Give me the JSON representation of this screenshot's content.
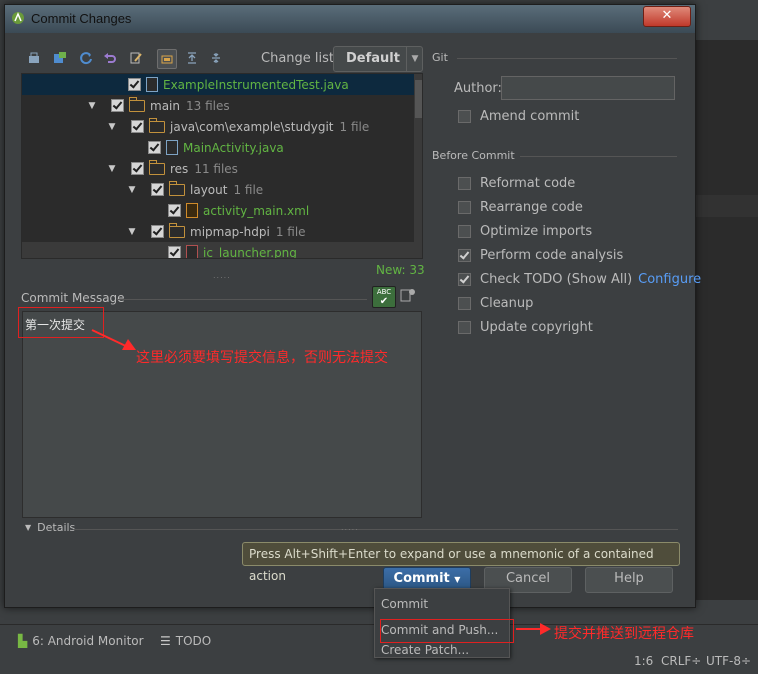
{
  "dialog": {
    "title": "Commit Changes",
    "close_label": "✕"
  },
  "toolbar": {
    "changelist_label": "Change list:",
    "changelist_value": "Default"
  },
  "tree": {
    "rows": [
      {
        "name": "ExampleInstrumentedTest.java",
        "count": "",
        "type": "file"
      },
      {
        "name": "main",
        "count": "13 files",
        "type": "folder"
      },
      {
        "name": "java\\com\\example\\studygit",
        "count": "1 file",
        "type": "folder"
      },
      {
        "name": "MainActivity.java",
        "count": "",
        "type": "file"
      },
      {
        "name": "res",
        "count": "11 files",
        "type": "folder"
      },
      {
        "name": "layout",
        "count": "1 file",
        "type": "folder"
      },
      {
        "name": "activity_main.xml",
        "count": "",
        "type": "xml"
      },
      {
        "name": "mipmap-hdpi",
        "count": "1 file",
        "type": "folder"
      },
      {
        "name": "ic_launcher.png",
        "count": "",
        "type": "png"
      }
    ],
    "new_count": "New: 33"
  },
  "commit_message": {
    "label": "Commit Message",
    "spell_label": "ABC",
    "value": "第一次提交",
    "annotation": "这里必须要填写提交信息，否则无法提交"
  },
  "details_label": "Details",
  "git": {
    "section": "Git",
    "author_label": "Author:",
    "author_value": "",
    "amend_label": "Amend commit"
  },
  "before_commit": {
    "section": "Before Commit",
    "options": [
      {
        "label": "Reformat code",
        "checked": false
      },
      {
        "label": "Rearrange code",
        "checked": false
      },
      {
        "label": "Optimize imports",
        "checked": false
      },
      {
        "label": "Perform code analysis",
        "checked": true
      },
      {
        "label": "Check TODO (Show All)",
        "checked": true
      },
      {
        "label": "Cleanup",
        "checked": false
      },
      {
        "label": "Update copyright",
        "checked": false
      }
    ],
    "configure_link": "Configure"
  },
  "tooltip": "Press Alt+Shift+Enter to expand or use a mnemonic of a contained action",
  "buttons": {
    "commit": "Commit",
    "cancel": "Cancel",
    "help": "Help"
  },
  "commit_menu": {
    "items": [
      "Commit",
      "Commit and Push...",
      "Create Patch..."
    ],
    "annotation": "提交并推送到远程仓库"
  },
  "ide": {
    "android_monitor": "6: Android Monitor",
    "todo": "TODO",
    "position": "1:6",
    "line_sep": "CRLF÷",
    "encoding": "UTF-8÷"
  },
  "colors": {
    "accent_red": "#ff2a2a",
    "link_blue": "#589df6",
    "file_green": "#62b543"
  }
}
